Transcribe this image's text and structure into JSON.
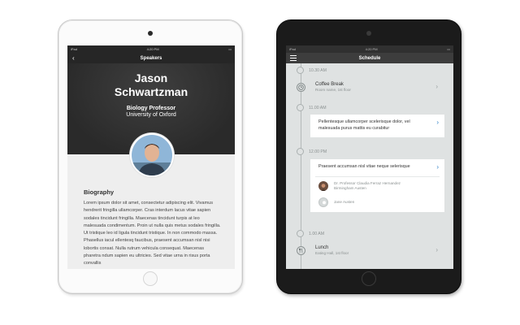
{
  "left_device": {
    "status": {
      "carrier": "iPad",
      "time": "4:20 PM"
    },
    "nav": {
      "back": "‹",
      "title": "Speakers"
    },
    "speaker": {
      "first_name": "Jason",
      "last_name": "Schwartzman",
      "role": "Biology Professor",
      "org": "University of Oxford"
    },
    "bio": {
      "heading": "Biography",
      "text": "Lorem ipsum dolor sit amet, consectetur adipiscing elit. Vivamus hendrerit fringilla ullamcorper. Cras interdum lacus vitae sapien sodales tincidunt fringilla. Maecenas tincidunt turpis at leo malesuada condimentum. Proin ut nulla quis metus sodales fringilla. Ut tristique leo id ligula tincidunt tristique. In non commodo massa. Phasellus iacul ellentesq faucibus, praesent accumsan nisl nisi lobortis consat. Nulla rutrum vehicula consequat. Maecenas pharetra ndum sapien eu ultricies. Sed vitae urna in risus porta convallis"
    }
  },
  "right_device": {
    "status": {
      "carrier": "iPad",
      "time": "4:20 PM"
    },
    "nav": {
      "title": "Schedule"
    },
    "times": [
      "10.30 AM",
      "11.00 AM",
      "12.00 PM",
      "1.00 AM"
    ],
    "coffee_break": {
      "title": "Coffee Break",
      "location": "Room name, 1st floor"
    },
    "card1": {
      "text": "Pellentesque ullamcorper scelerisque dolor, vel malesuada purus mattis eu curabitur"
    },
    "card2": {
      "text": "Praesent accumsan nisl vitae neque selerisque",
      "speakers": [
        {
          "line1": "Dr. Professor Claudia Ferraz Hernandez",
          "line2": "Birmingham Austen"
        },
        {
          "line1": "Jane Austen",
          "line2": ""
        }
      ]
    },
    "lunch": {
      "title": "Lunch",
      "location": "Eating Hall, 1st floor"
    }
  },
  "colors": {
    "accent": "#2d7fc6",
    "dark_header": "#2f2f2f",
    "schedule_bg": "#dfe2e2"
  }
}
